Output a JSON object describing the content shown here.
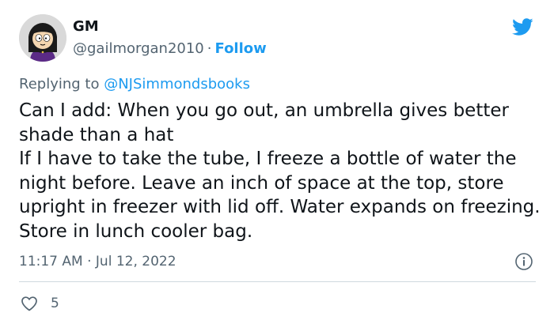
{
  "author": {
    "display_name": "GM",
    "handle": "@gailmorgan2010",
    "separator": "·",
    "follow_label": "Follow"
  },
  "reply": {
    "prefix": "Replying to",
    "mention": "@NJSimmondsbooks"
  },
  "tweet": {
    "line1": "Can I add: When you go out, an umbrella gives better shade than a hat",
    "line2": "If I have to take the tube, I freeze a bottle of water the night before. Leave an inch of space at the top, store upright in freezer with lid off. Water expands on freezing. Store in lunch cooler bag."
  },
  "meta": {
    "timestamp": "11:17 AM · Jul 12, 2022",
    "likes": "5"
  },
  "icons": {
    "brand": "twitter-bird-icon",
    "info": "info-icon",
    "like": "heart-icon"
  },
  "colors": {
    "accent": "#1d9bf0",
    "secondary_text": "#536471",
    "primary_text": "#0f1419",
    "divider": "#cfd9de"
  }
}
